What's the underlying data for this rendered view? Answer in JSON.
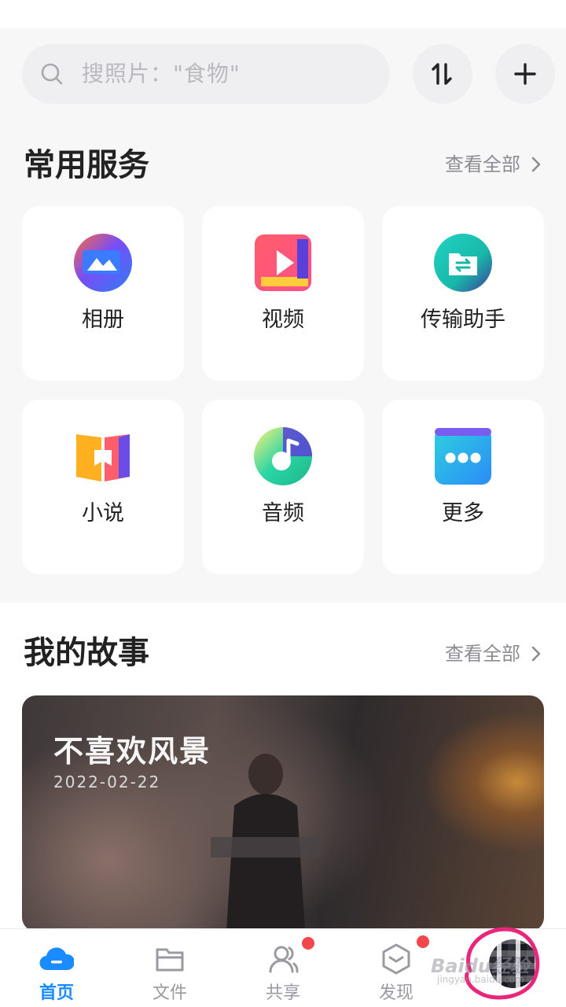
{
  "search": {
    "placeholder": "搜照片：\"食物\""
  },
  "common_services": {
    "title": "常用服务",
    "view_all": "查看全部",
    "items": [
      {
        "label": "相册",
        "icon": "album-icon"
      },
      {
        "label": "视频",
        "icon": "video-icon"
      },
      {
        "label": "传输助手",
        "icon": "transfer-assistant-icon"
      },
      {
        "label": "小说",
        "icon": "novel-icon"
      },
      {
        "label": "音频",
        "icon": "audio-icon"
      },
      {
        "label": "更多",
        "icon": "more-icon"
      }
    ]
  },
  "my_stories": {
    "title": "我的故事",
    "view_all": "查看全部",
    "card": {
      "title": "不喜欢风景",
      "subtitle": "2022-02-22"
    }
  },
  "bottom_nav": {
    "items": [
      {
        "label": "首页",
        "icon": "cloud-home-icon",
        "active": true
      },
      {
        "label": "文件",
        "icon": "folder-icon",
        "active": false
      },
      {
        "label": "共享",
        "icon": "share-people-icon",
        "active": false,
        "badge": true
      },
      {
        "label": "发现",
        "icon": "discover-cube-icon",
        "active": false,
        "badge": true
      },
      {
        "label": "",
        "icon": "avatar",
        "active": false
      }
    ]
  },
  "watermark": {
    "text": "Baidu经验",
    "url_text": "jingyan.baidu.com"
  },
  "colors": {
    "accent": "#1a8cff",
    "badge": "#f2484b",
    "annotation_ring": "#e8267a"
  }
}
